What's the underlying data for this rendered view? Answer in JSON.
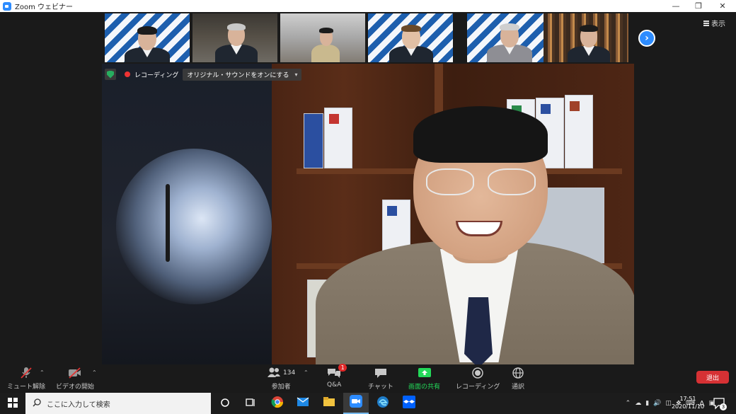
{
  "window": {
    "title": "Zoom ウェビナー"
  },
  "thumbnails": {
    "next_icon": "chevron-right-icon",
    "view_label": "表示"
  },
  "main_video": {
    "recording_label": "レコーディング",
    "original_sound_label": "オリジナル・サウンドをオンにする"
  },
  "toolbar": {
    "unmute_label": "ミュート解除",
    "start_video_label": "ビデオの開始",
    "participants_label": "参加者",
    "participants_count": "134",
    "qa_label": "Q&A",
    "qa_badge": "1",
    "chat_label": "チャット",
    "share_label": "画面の共有",
    "recording_label": "レコーディング",
    "interpretation_label": "通訳",
    "leave_label": "退出"
  },
  "taskbar": {
    "search_placeholder": "ここに入力して検索",
    "time": "17:51",
    "date": "2020/11/10",
    "ime_label": "A",
    "notification_count": "3"
  },
  "colors": {
    "accent": "#2d8cff",
    "share_green": "#23d959",
    "leave_red": "#d63134"
  }
}
